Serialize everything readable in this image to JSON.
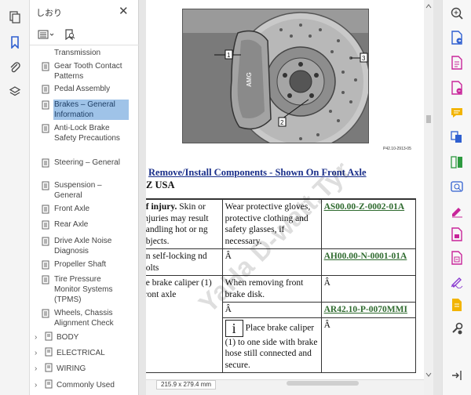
{
  "left_rail": {
    "icons": [
      "pages-icon",
      "bookmark-icon",
      "attachment-icon",
      "layers-icon"
    ]
  },
  "bookmarks_panel": {
    "title": "しおり",
    "items": [
      {
        "label": "Transmission",
        "selected": false
      },
      {
        "label": "Gear Tooth Contact Patterns",
        "selected": false
      },
      {
        "label": "Pedal Assembly",
        "selected": false
      },
      {
        "label": "Brakes – General Information",
        "selected": true
      },
      {
        "label": "Anti-Lock Brake Safety Precautions",
        "selected": false
      },
      {
        "label": "Steering – General",
        "selected": false
      },
      {
        "label": "Suspension – General",
        "selected": false
      },
      {
        "label": "Front Axle",
        "selected": false
      },
      {
        "label": "Rear Axle",
        "selected": false
      },
      {
        "label": "Drive Axle Noise Diagnosis",
        "selected": false
      },
      {
        "label": "Propeller Shaft",
        "selected": false
      },
      {
        "label": "Tire Pressure Monitor Systems (TPMS)",
        "selected": false
      },
      {
        "label": "Wheels, Chassis Alignment Check",
        "selected": false
      }
    ],
    "groups": [
      {
        "label": "BODY"
      },
      {
        "label": "ELECTRICAL"
      },
      {
        "label": "WIRING"
      },
      {
        "label": "Commonly Used"
      }
    ]
  },
  "document": {
    "figure_callouts": [
      "1",
      "2",
      "3"
    ],
    "figure_caption": "P42.10-2913-05",
    "heading": "Remove/Install Components - Shown On Front Axle",
    "subheading": "Z USA",
    "table": {
      "r1c1a": "of injury.",
      "r1c1b": " Skin or injuries may result handling hot or ng objects.",
      "r1c2": "Wear protective gloves, protective clothing and safety glasses, if necessary.",
      "r1c3": "AS00.00-Z-0002-01A",
      "r2c1": "on self-locking nd bolts",
      "r2c2": "Â",
      "r2c3": "AH00.00-N-0001-01A",
      "r3c1": "ve brake caliper (1) front axle",
      "r3c2": "When removing front brake disk.",
      "r3c3": "Â",
      "r4c2": "Â",
      "r4c3": "AR42.10-P-0070MMI",
      "r5c2icon": "i",
      "r5c2": "Place brake caliper (1) to one side with brake hose still connected and secure.",
      "r5c3": "Â"
    },
    "watermark": "YaHa  D-watt.Tyr"
  },
  "status": {
    "page_size": "215.9 x 279.4 mm"
  },
  "right_rail": {
    "icons": [
      "zoom-icon",
      "export-pdf-icon",
      "create-pdf-icon",
      "edit-pdf-icon",
      "comment-icon",
      "combine-files-icon",
      "organize-pages-icon",
      "redact-icon",
      "protect-icon",
      "fill-sign-icon",
      "scan-ocr-icon",
      "prepare-form-icon",
      "send-for-signature-icon",
      "stamp-icon",
      "more-tools-icon",
      "collapse-icon"
    ]
  },
  "colors": {
    "selection": "#9fc3e8",
    "heading_blue": "#1a2f8a",
    "link_green": "#2f6b2f",
    "rail_pink": "#c8259a",
    "rail_blue": "#2f5fd0"
  }
}
